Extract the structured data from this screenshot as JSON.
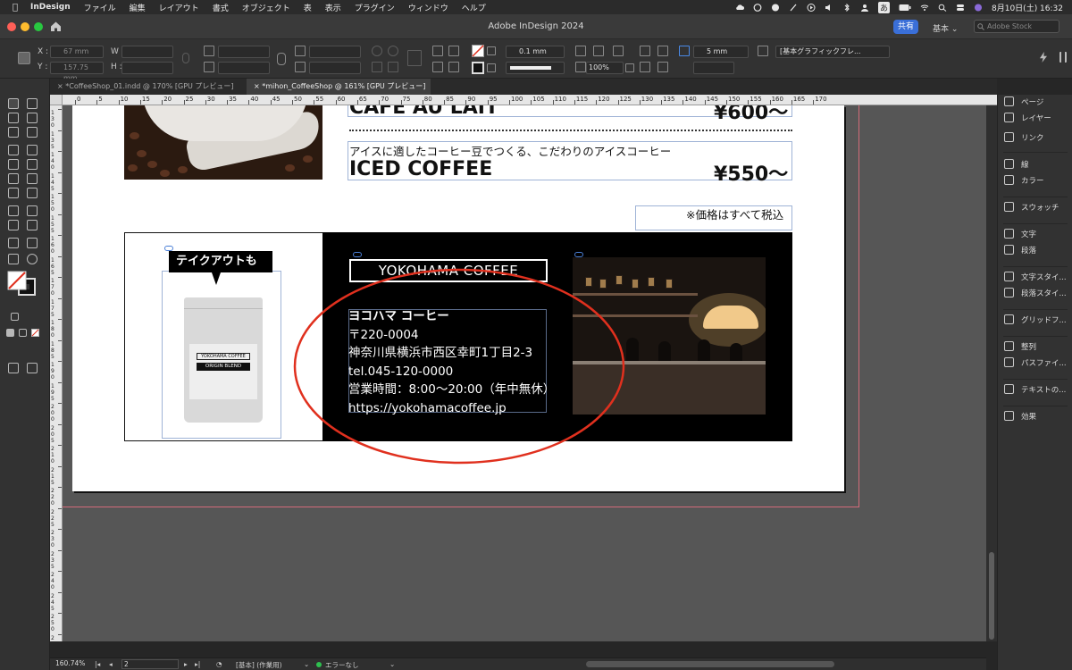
{
  "menubar": {
    "app": "InDesign",
    "items": [
      "ファイル",
      "編集",
      "レイアウト",
      "書式",
      "オブジェクト",
      "表",
      "表示",
      "プラグイン",
      "ウィンドウ",
      "ヘルプ"
    ],
    "ime": "あ",
    "clock": "8月10日(土) 16:32"
  },
  "titlebar": {
    "title": "Adobe InDesign 2024",
    "share_label": "共有",
    "workspace": "基本",
    "stock_placeholder": "Adobe Stock"
  },
  "control": {
    "x_label": "X :",
    "y_label": "Y :",
    "w_label": "W :",
    "h_label": "H :",
    "x_value": "67 mm",
    "y_value": "157.75 mm",
    "stroke_weight": "0.1 mm",
    "opacity": "100%",
    "gap": "5 mm",
    "object_style": "[基本グラフィックフレ..."
  },
  "tabs": [
    {
      "label": "*CoffeeShop_01.indd @ 170% [GPU プレビュー]",
      "active": false
    },
    {
      "label": "*mihon_CoffeeShop @ 161% [GPU プレビュー]",
      "active": true
    }
  ],
  "ruler": {
    "h_ticks": [
      "0",
      "5",
      "10",
      "15",
      "20",
      "25",
      "30",
      "35",
      "40",
      "45",
      "50",
      "55",
      "60",
      "65",
      "70",
      "75",
      "80",
      "85",
      "90",
      "95",
      "100",
      "105",
      "110",
      "115",
      "120",
      "125",
      "130",
      "135",
      "140",
      "145",
      "150",
      "155",
      "160",
      "165",
      "170"
    ],
    "v_ticks": [
      "130",
      "135",
      "140",
      "145",
      "150",
      "155",
      "160",
      "165",
      "170",
      "175",
      "180",
      "185",
      "190",
      "195",
      "200",
      "205",
      "210",
      "215",
      "220",
      "225",
      "230",
      "235",
      "240",
      "245",
      "250",
      "255"
    ]
  },
  "panels": [
    {
      "icon": "pages-icon",
      "label": "ページ"
    },
    {
      "icon": "layers-icon",
      "label": "レイヤー"
    },
    {
      "icon": "links-icon",
      "label": "リンク"
    },
    {
      "icon": "stroke-icon",
      "label": "線"
    },
    {
      "icon": "color-icon",
      "label": "カラー"
    },
    {
      "icon": "swatches-icon",
      "label": "スウォッチ"
    },
    {
      "icon": "character-icon",
      "label": "文字"
    },
    {
      "icon": "paragraph-icon",
      "label": "段落"
    },
    {
      "icon": "character-styles-icon",
      "label": "文字スタイ..."
    },
    {
      "icon": "paragraph-styles-icon",
      "label": "段落スタイ..."
    },
    {
      "icon": "grid-format-icon",
      "label": "グリッドフ..."
    },
    {
      "icon": "align-icon",
      "label": "整列"
    },
    {
      "icon": "pathfinder-icon",
      "label": "パスファイ..."
    },
    {
      "icon": "text-wrap-icon",
      "label": "テキストの..."
    },
    {
      "icon": "effects-icon",
      "label": "効果"
    }
  ],
  "document": {
    "cafe_au_lait_name": "CAFE AU LAIT",
    "cafe_au_lait_price": "¥600〜",
    "iced_coffee_desc": "アイスに適したコーヒー豆でつくる、こだわりのアイスコーヒー",
    "iced_coffee_name": "ICED COFFEE",
    "iced_coffee_price": "¥550〜",
    "tax_note": "※価格はすべて税込",
    "takeout_label": "テイクアウトも",
    "bag_label_top": "YOKOHAMA COFFEE",
    "bag_label_bottom": "ORIGIN BLEND",
    "shop_logo": "YOKOHAMA COFFEE",
    "address_lines": [
      "ヨコハマ コーヒー",
      "〒220-0004",
      "神奈川県横浜市西区幸町1丁目2-3",
      "tel.045-120-0000",
      "営業時間：8:00〜20:00（年中無休）",
      "https://yokohamacoffee.jp"
    ]
  },
  "status": {
    "zoom": "160.74%",
    "page": "2",
    "base": "[基本] (作業用)",
    "preflight": "エラーなし"
  },
  "colors": {
    "annotation_ellipse": "#e0301e",
    "preflight_ok": "#2ec04f",
    "share_button": "#3a6fd8"
  }
}
